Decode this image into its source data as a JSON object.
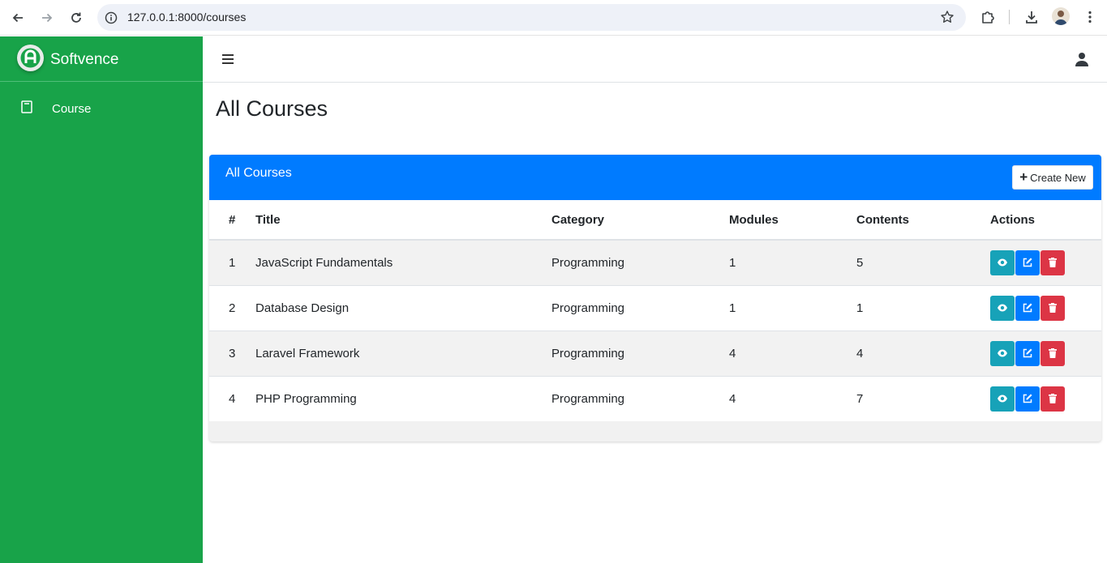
{
  "browser": {
    "url": "127.0.0.1:8000/courses"
  },
  "sidebar": {
    "brand": "Softvence",
    "items": [
      {
        "label": "Course"
      }
    ]
  },
  "page": {
    "title": "All Courses"
  },
  "card": {
    "title": "All Courses",
    "create_label": "Create New"
  },
  "table": {
    "headers": {
      "num": "#",
      "title": "Title",
      "category": "Category",
      "modules": "Modules",
      "contents": "Contents",
      "actions": "Actions"
    },
    "rows": [
      {
        "num": "1",
        "title": "JavaScript Fundamentals",
        "category": "Programming",
        "modules": "1",
        "contents": "5"
      },
      {
        "num": "2",
        "title": "Database Design",
        "category": "Programming",
        "modules": "1",
        "contents": "1"
      },
      {
        "num": "3",
        "title": "Laravel Framework",
        "category": "Programming",
        "modules": "4",
        "contents": "4"
      },
      {
        "num": "4",
        "title": "PHP Programming",
        "category": "Programming",
        "modules": "4",
        "contents": "7"
      }
    ]
  },
  "colors": {
    "sidebar": "#18a349",
    "header": "#007bff",
    "view": "#17a2b8",
    "edit": "#007bff",
    "delete": "#dc3545"
  }
}
